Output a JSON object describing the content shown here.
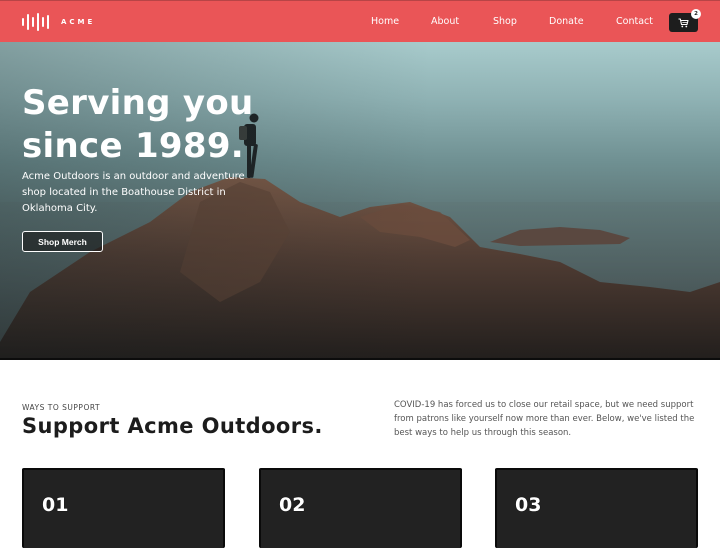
{
  "nav": {
    "brand": "ACME",
    "links": [
      {
        "label": "Home"
      },
      {
        "label": "About"
      },
      {
        "label": "Shop"
      },
      {
        "label": "Donate"
      },
      {
        "label": "Contact"
      }
    ],
    "cart": {
      "icon": "cart-icon",
      "count": "2"
    },
    "colors": {
      "background": "#ea5557",
      "cart_background": "#1d1d1d"
    }
  },
  "hero": {
    "title_line1": "Serving you",
    "title_line2": "since 1989.",
    "description": "Acme Outdoors is an outdoor and adventure shop located in the Boathouse District in Oklahoma City.",
    "button_label": "Shop Merch",
    "image": "hiker-on-rocky-cliff-by-sea"
  },
  "support": {
    "eyebrow": "WAYS TO SUPPORT",
    "title": "Support Acme Outdoors.",
    "description": "COVID-19 has forced us to close our retail space, but we need support from patrons like yourself now more than ever. Below, we've listed the best ways to help us through this season.",
    "cards": [
      {
        "number": "01"
      },
      {
        "number": "02"
      },
      {
        "number": "03"
      }
    ]
  }
}
